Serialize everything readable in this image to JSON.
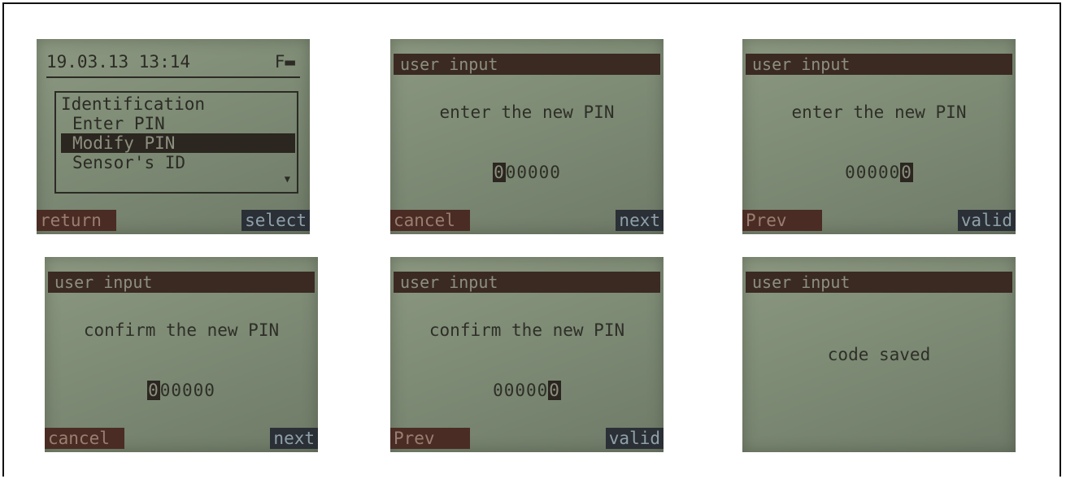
{
  "screens": [
    {
      "datetime": "19.03.13 13:14",
      "battery": "F▬",
      "menu_title": "Identification",
      "menu_items": [
        "Enter PIN",
        "Modify PIN",
        "Sensor's ID"
      ],
      "scroll_arrow": "▼",
      "left_key": "return",
      "right_key": "select"
    },
    {
      "header": "user input",
      "prompt": "enter the new PIN",
      "pin_cursor": "0",
      "pin_rest": "00000",
      "left_key": "cancel",
      "right_key": "next"
    },
    {
      "header": "user input",
      "prompt": "enter the new PIN",
      "pin_rest": "00000",
      "pin_cursor": "0",
      "left_key": "Prev",
      "right_key": "valid"
    },
    {
      "header": "user input",
      "prompt": "confirm the new PIN",
      "pin_cursor": "0",
      "pin_rest": "00000",
      "left_key": "cancel",
      "right_key": "next"
    },
    {
      "header": "user input",
      "prompt": "confirm the new PIN",
      "pin_rest": "00000",
      "pin_cursor": "0",
      "left_key": "Prev",
      "right_key": "valid"
    },
    {
      "header": "user input",
      "message": "code saved"
    }
  ]
}
